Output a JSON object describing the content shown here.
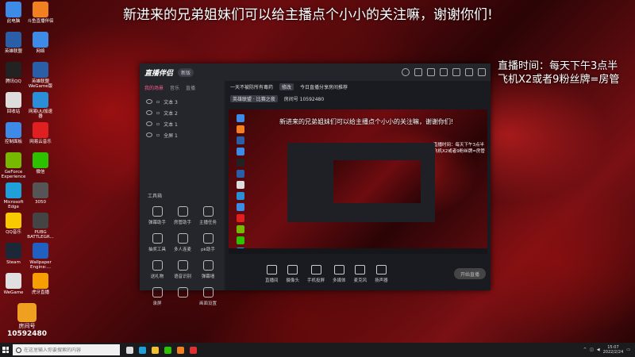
{
  "banner": "新进来的兄弟姐妹们可以给主播点个小小的关注嘛，谢谢你们!",
  "stream_info": {
    "line1": "直播时间：每天下午3点半",
    "line2": "飞机X2或者9粉丝牌=房管"
  },
  "desktop_icons": [
    {
      "label": "此电脑",
      "icon": "computer-icon",
      "color": "#3d8be6"
    },
    {
      "label": "斗鱼直播伴侣",
      "icon": "douyu-icon",
      "color": "#f08020"
    },
    {
      "label": "英雄联盟",
      "icon": "lol-icon",
      "color": "#2a5fa8"
    },
    {
      "label": "网络",
      "icon": "network-icon",
      "color": "#3d8be6"
    },
    {
      "label": "腾讯QQ",
      "icon": "qq-icon",
      "color": "#222"
    },
    {
      "label": "英雄联盟 WeGame版",
      "icon": "lol-wegame-icon",
      "color": "#2a5fa8"
    },
    {
      "label": "回收站",
      "icon": "recycle-bin-icon",
      "color": "#ddd"
    },
    {
      "label": "网易UU加速器",
      "icon": "uu-icon",
      "color": "#2a8fd8"
    },
    {
      "label": "控制面板",
      "icon": "control-panel-icon",
      "color": "#3d8be6"
    },
    {
      "label": "网易云音乐",
      "icon": "netease-music-icon",
      "color": "#e02020"
    },
    {
      "label": "GeForce Experience",
      "icon": "nvidia-icon",
      "color": "#76b900"
    },
    {
      "label": "微信",
      "icon": "wechat-icon",
      "color": "#2dc100"
    },
    {
      "label": "Microsoft Edge",
      "icon": "edge-icon",
      "color": "#1fa0d8"
    },
    {
      "label": "3050",
      "icon": "gpu-icon",
      "color": "#555"
    },
    {
      "label": "QQ音乐",
      "icon": "qq-music-icon",
      "color": "#f8c800"
    },
    {
      "label": "PUBG BATTLEGR...",
      "icon": "pubg-icon",
      "color": "#444"
    },
    {
      "label": "Steam",
      "icon": "steam-icon",
      "color": "#1b2838"
    },
    {
      "label": "Wallpaper Engine:...",
      "icon": "wallpaper-engine-icon",
      "color": "#2060c0"
    },
    {
      "label": "WeGame",
      "icon": "wegame-icon",
      "color": "#e0e0e0"
    },
    {
      "label": "虎牙直播",
      "icon": "huya-icon",
      "color": "#f5a000"
    }
  ],
  "streamer_badge": {
    "label": "房间号",
    "room": "10592480"
  },
  "app": {
    "brand": "直播伴侣",
    "version": "新版",
    "tabs": [
      "我的场景",
      "音乐",
      "直播"
    ],
    "layers": [
      "文本 3",
      "文本 2",
      "文本 1",
      "全屏 1"
    ],
    "tools_title": "工具箱",
    "tools": [
      "弹幕助手",
      "房管助手",
      "主播任务",
      "抽奖工具",
      "多人连麦",
      "pk助手",
      "送礼物",
      "语音识别",
      "弹幕墙",
      "录屏",
      "",
      "画面设置"
    ],
    "stream_title": "一天不被防所有毒药",
    "tag": "修改",
    "room_tag": "今日直播分享房间推荐",
    "category": "英雄联盟 · 比赛之夜",
    "room_id": "房间号 10592480",
    "bottom_buttons": [
      "直播间",
      "摄像头",
      "手机投屏",
      "多媒体",
      "麦克风",
      "扬声器"
    ],
    "start_live": "开始直播"
  },
  "taskbar": {
    "search_placeholder": "在这里输入你要搜索的内容",
    "apps": [
      {
        "icon": "task-view-icon",
        "color": "#ddd"
      },
      {
        "icon": "edge-icon",
        "color": "#1fa0d8"
      },
      {
        "icon": "file-explorer-icon",
        "color": "#f0c030"
      },
      {
        "icon": "wechat-icon",
        "color": "#2dc100"
      },
      {
        "icon": "douyu-icon",
        "color": "#f08020"
      },
      {
        "icon": "app-icon",
        "color": "#e03030"
      }
    ],
    "time": "15:07",
    "date": "2022/2/24"
  }
}
